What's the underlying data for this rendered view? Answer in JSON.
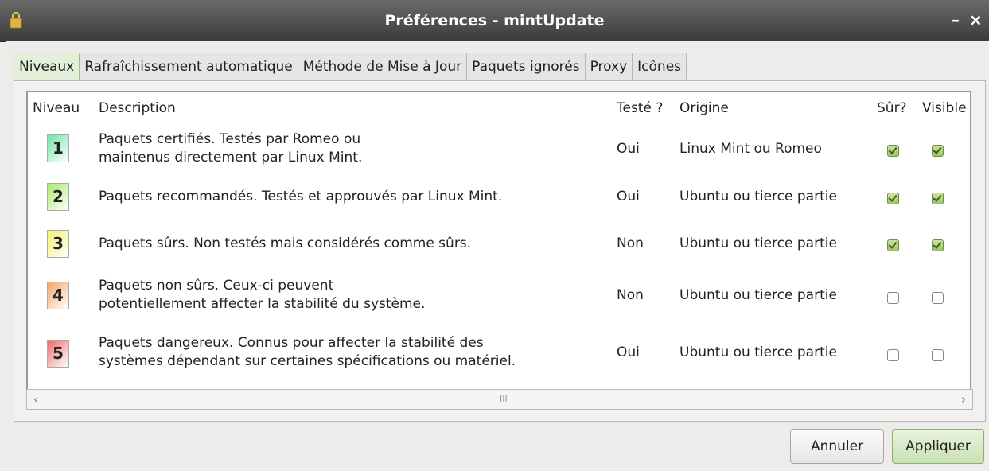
{
  "window": {
    "title": "Préférences - mintUpdate",
    "minimize": "–",
    "close": "×"
  },
  "tabs": [
    {
      "label": "Niveaux"
    },
    {
      "label": "Rafraîchissement automatique"
    },
    {
      "label": "Méthode de Mise à Jour"
    },
    {
      "label": "Paquets ignorés"
    },
    {
      "label": "Proxy"
    },
    {
      "label": "Icônes"
    }
  ],
  "columns": {
    "level": "Niveau",
    "description": "Description",
    "tested": "Testé ?",
    "origin": "Origine",
    "safe": "Sûr?",
    "visible": "Visible"
  },
  "rows": [
    {
      "level": "1",
      "color": "#6fe3a6",
      "description_1": "Paquets certifiés. Testés par Romeo ou",
      "description_2": "maintenus directement par Linux Mint.",
      "tested": "Oui",
      "origin": "Linux Mint ou Romeo",
      "safe": true,
      "visible": true
    },
    {
      "level": "2",
      "color": "#a8ec6a",
      "description_1": "Paquets recommandés. Testés et approuvés par Linux Mint.",
      "description_2": "",
      "tested": "Oui",
      "origin": "Ubuntu ou tierce partie",
      "safe": true,
      "visible": true
    },
    {
      "level": "3",
      "color": "#f5f06a",
      "description_1": "Paquets sûrs. Non testés mais considérés comme sûrs.",
      "description_2": "",
      "tested": "Non",
      "origin": "Ubuntu ou tierce partie",
      "safe": true,
      "visible": true
    },
    {
      "level": "4",
      "color": "#f5a66a",
      "description_1": "Paquets non sûrs. Ceux-ci peuvent",
      "description_2": "potentiellement affecter la stabilité du système.",
      "tested": "Non",
      "origin": "Ubuntu ou tierce partie",
      "safe": false,
      "visible": false
    },
    {
      "level": "5",
      "color": "#f06a6a",
      "description_1": "Paquets dangereux. Connus pour affecter la stabilité des",
      "description_2": "systèmes dépendant sur certaines spécifications ou matériel.",
      "tested": "Oui",
      "origin": "Ubuntu ou tierce partie",
      "safe": false,
      "visible": false
    }
  ],
  "scrollbar": {
    "left": "‹",
    "right": "›",
    "grip": "III"
  },
  "buttons": {
    "cancel": "Annuler",
    "apply": "Appliquer"
  }
}
